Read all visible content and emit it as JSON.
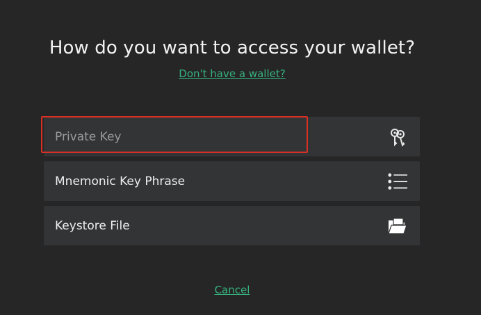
{
  "dialog": {
    "title": "How do you want to access your wallet?",
    "no_wallet_link": "Don't have a wallet?",
    "cancel_link": "Cancel"
  },
  "options": [
    {
      "label": "Private Key",
      "icon": "keys-icon",
      "state": "selected"
    },
    {
      "label": "Mnemonic Key Phrase",
      "icon": "list-icon"
    },
    {
      "label": "Keystore File",
      "icon": "folder-icon"
    }
  ],
  "colors": {
    "background": "#262627",
    "option_background": "#333435",
    "accent_link": "#36b37e",
    "highlight_border": "#d93025",
    "text_primary": "#efefef",
    "text_muted": "#9a9b9d"
  }
}
